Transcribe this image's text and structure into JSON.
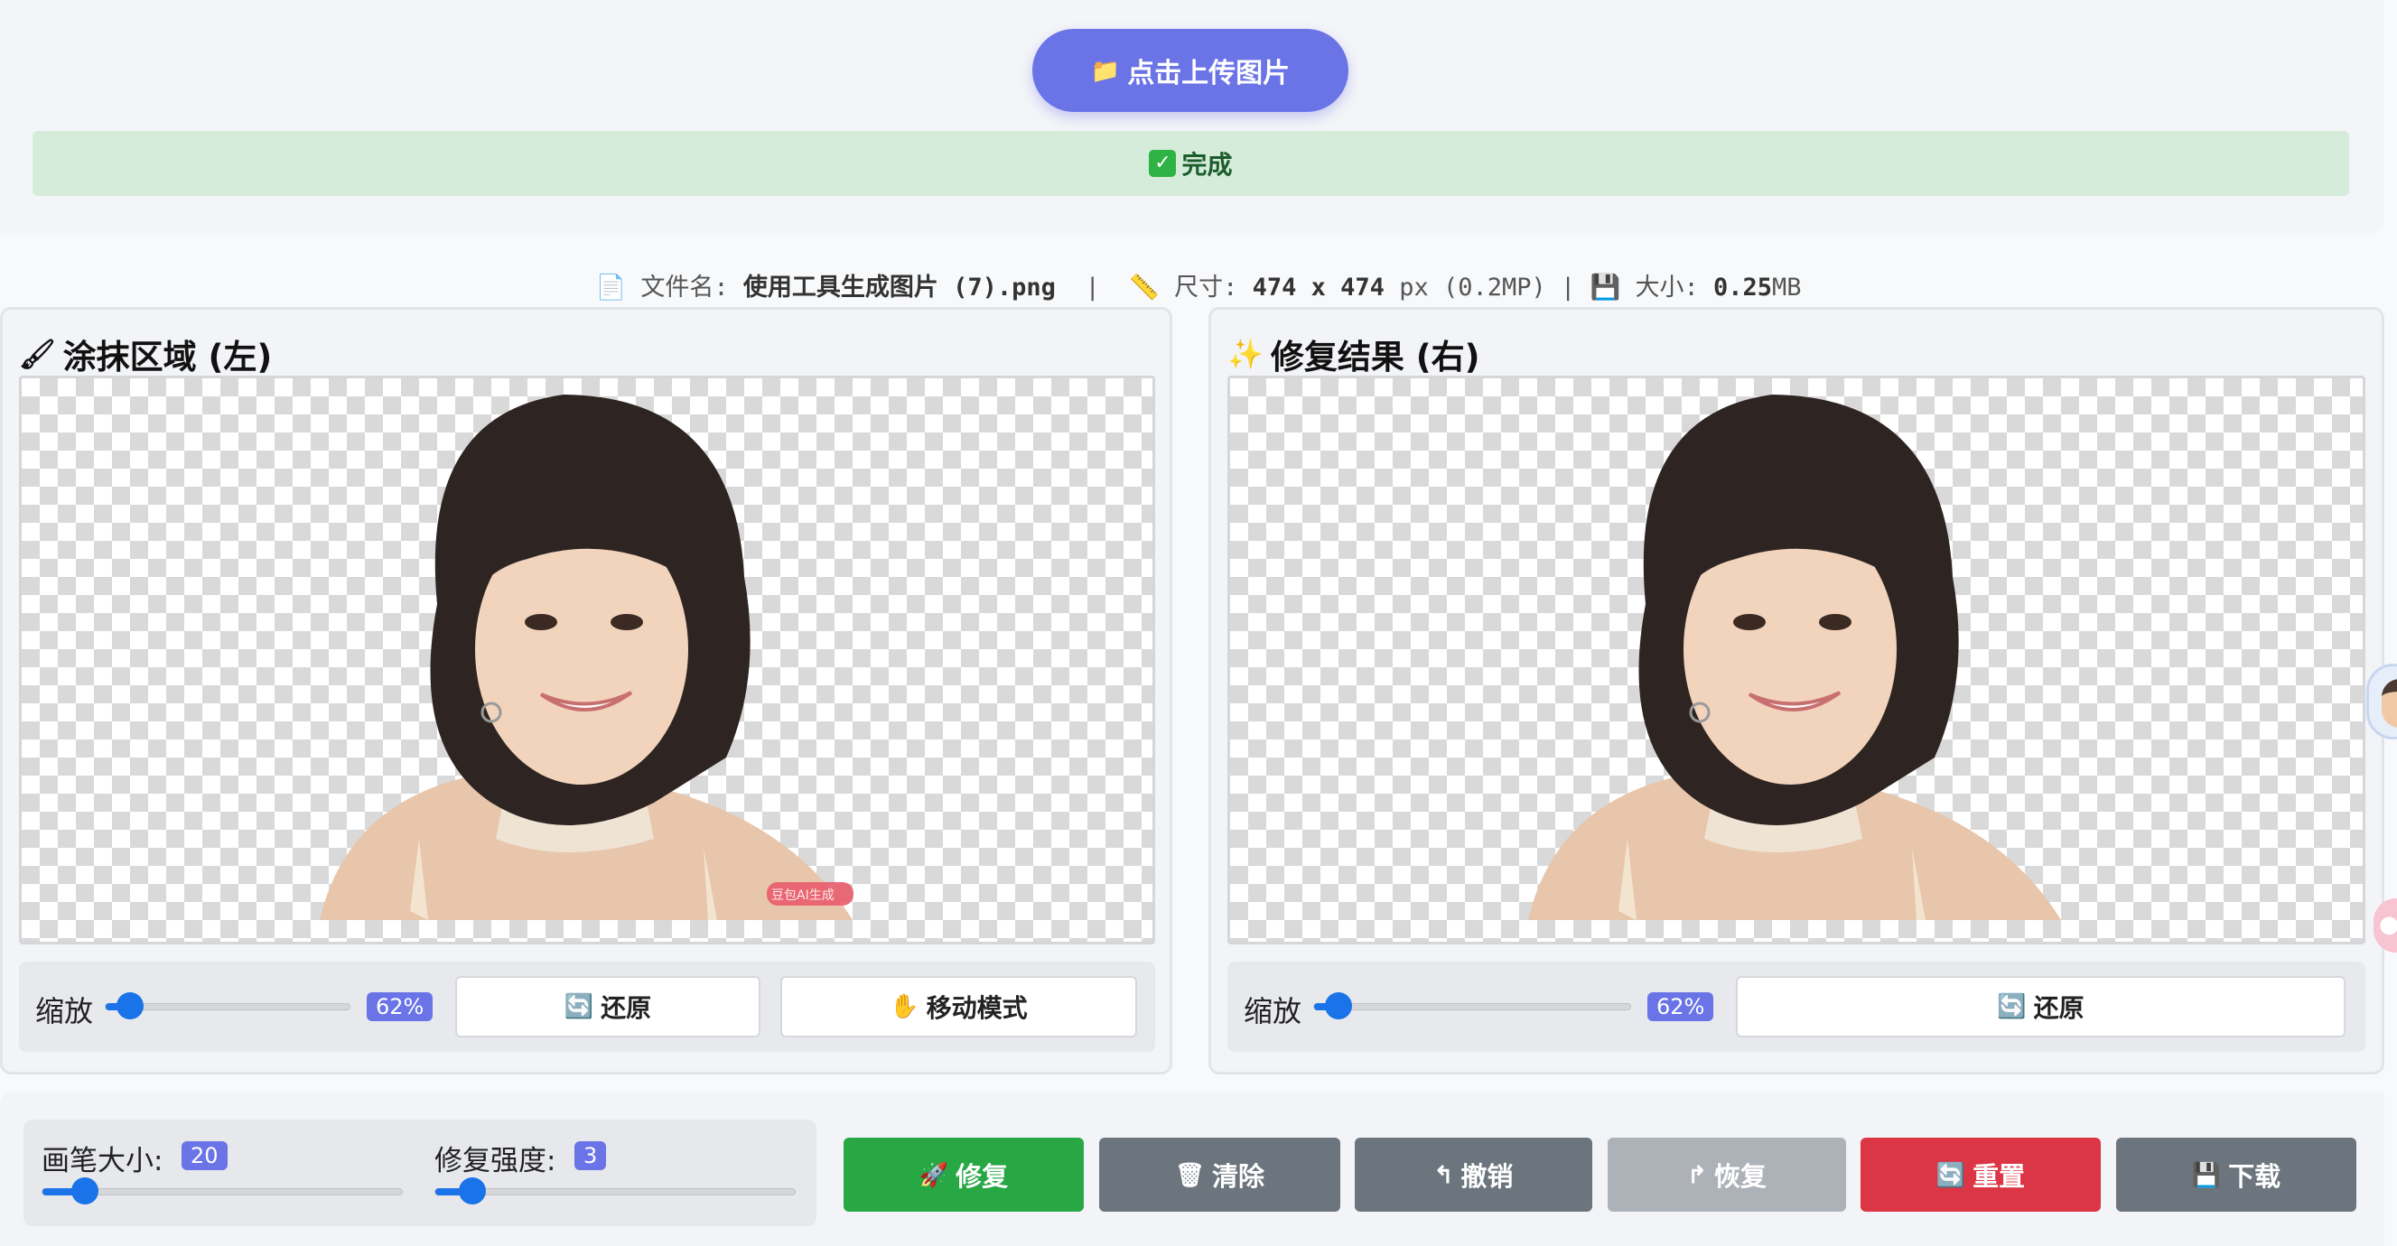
{
  "upload": {
    "icon": "folder-icon",
    "label": "点击上传图片"
  },
  "status": {
    "icon": "check-icon",
    "text": "完成"
  },
  "file_info": {
    "name_label": "文件名:",
    "name_value": "使用工具生成图片 (7).png",
    "size_label": "尺寸:",
    "dim_value": "474 x 474",
    "dim_unit": "px (0.2MP)",
    "weight_label": "大小:",
    "weight_value": "0.25",
    "weight_unit": "MB",
    "separator": "|"
  },
  "left_panel": {
    "title": "涂抹区域 (左)",
    "icon": "paintbrush-icon",
    "watermark": "豆包AI生成",
    "zoom_label": "缩放",
    "zoom_value": "62%",
    "zoom_fraction": 0.62,
    "reset_label": "还原",
    "move_label": "移动模式"
  },
  "right_panel": {
    "title": "修复结果 (右)",
    "icon": "sparkles-icon",
    "zoom_label": "缩放",
    "zoom_value": "62%",
    "zoom_fraction": 0.62,
    "reset_label": "还原"
  },
  "toolbar": {
    "brush_label": "画笔大小:",
    "brush_value": "20",
    "strength_label": "修复强度:",
    "strength_value": "3",
    "buttons": [
      {
        "label": "修复",
        "icon": "rocket-icon",
        "color": "#28a745"
      },
      {
        "label": "清除",
        "icon": "trash-icon",
        "color": "#6c757d"
      },
      {
        "label": "撤销",
        "icon": "undo-icon",
        "color": "#6c757d"
      },
      {
        "label": "恢复",
        "icon": "redo-icon",
        "color": "#adb1b8"
      },
      {
        "label": "重置",
        "icon": "refresh-icon",
        "color": "#dc3545"
      },
      {
        "label": "下载",
        "icon": "floppy-disk-icon",
        "color": "#6c757d"
      }
    ]
  },
  "colors": {
    "accent": "#6b74e6",
    "success_bg": "#d5ecda",
    "slider": "#1a73e8"
  }
}
